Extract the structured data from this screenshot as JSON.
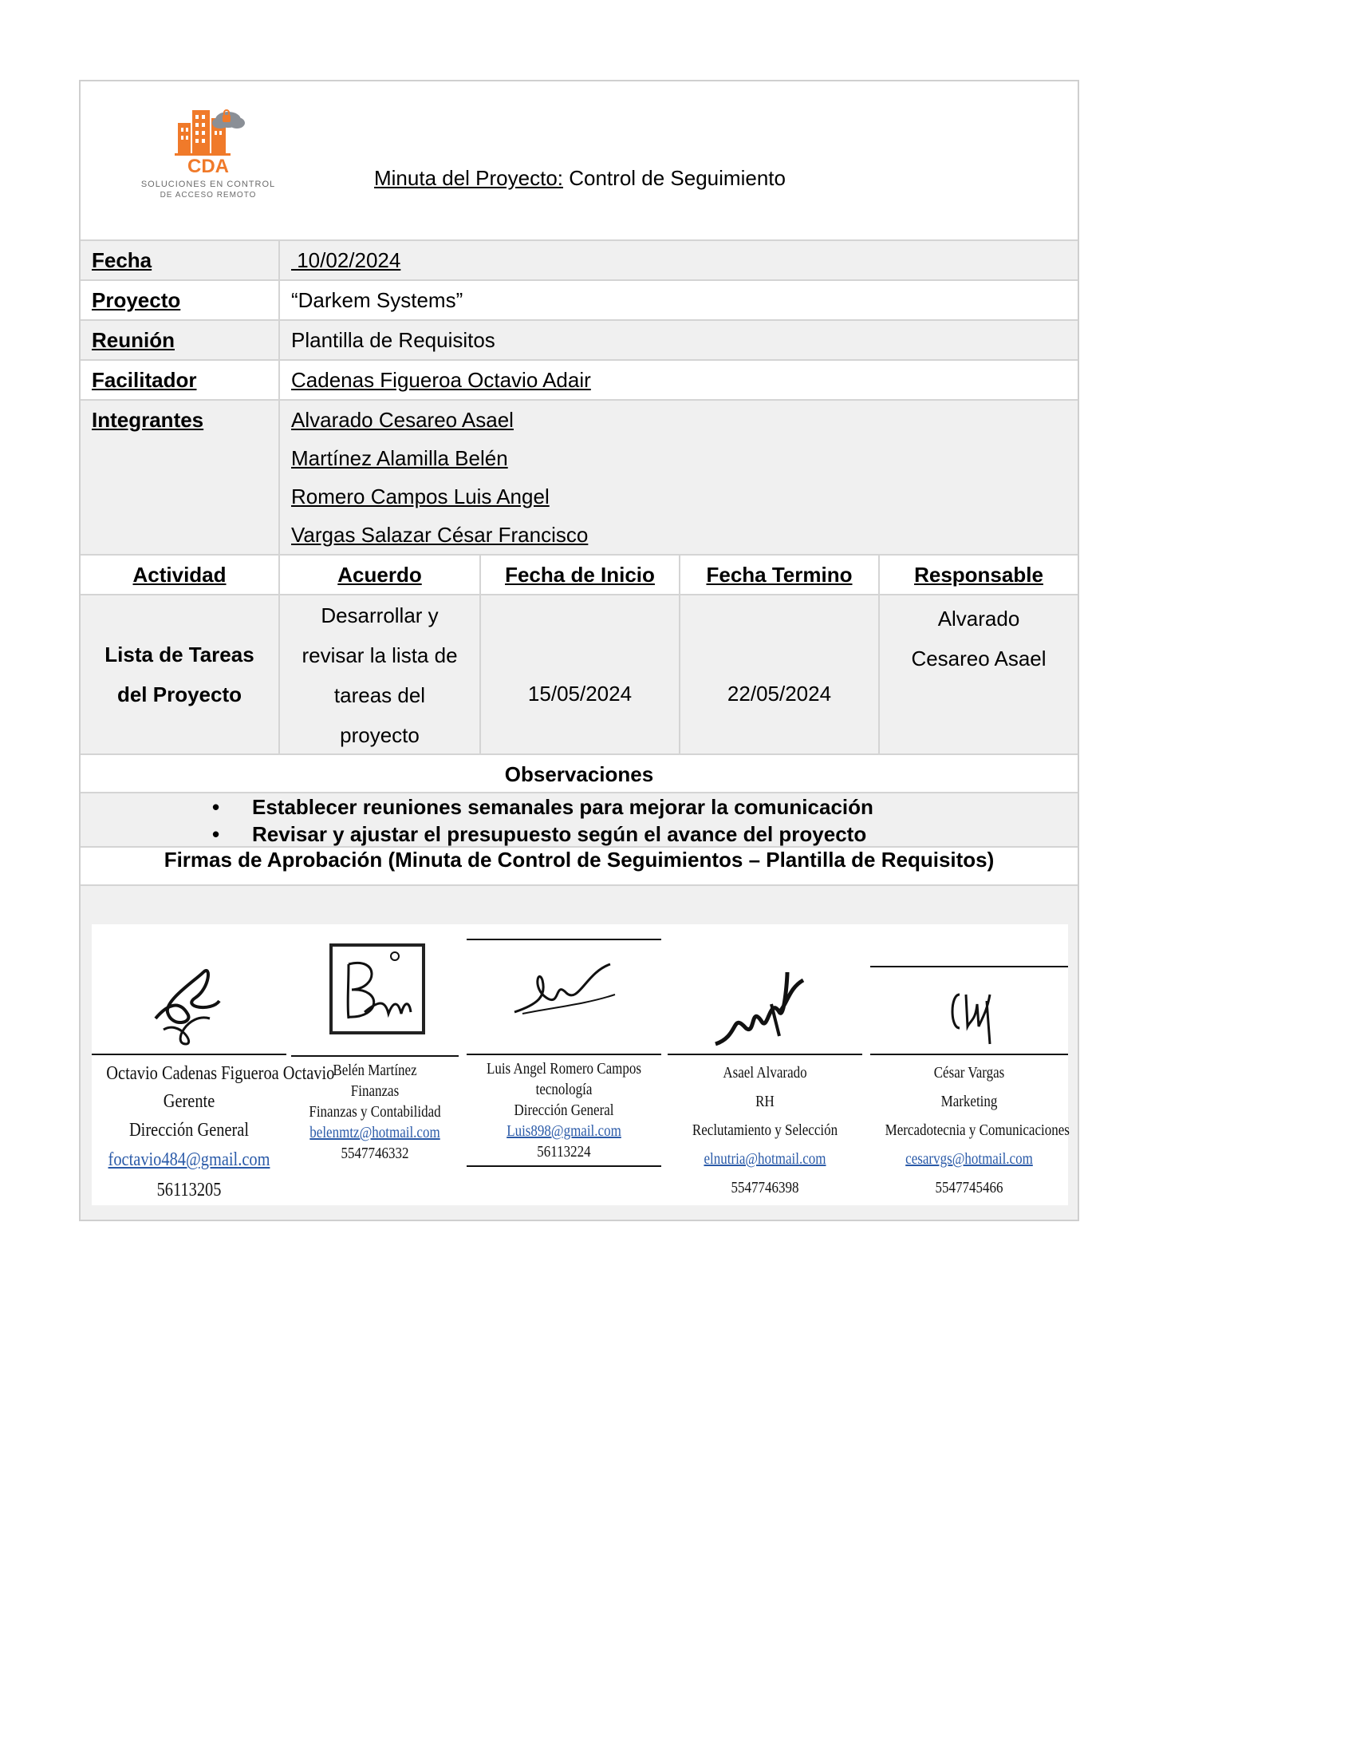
{
  "header": {
    "logo_text": "CDA",
    "logo_tagline_1": "SOLUCIONES EN CONTROL",
    "logo_tagline_2": "DE ACCESO REMOTO",
    "title_prefix": "Minuta del Proyecto:",
    "title_rest": " Control de Seguimiento"
  },
  "info": {
    "fecha_label": "Fecha",
    "fecha_value": " 10/02/2024",
    "proyecto_label": "Proyecto",
    "proyecto_value": "“Darkem Systems”",
    "reunion_label": "Reunión",
    "reunion_value": "Plantilla de Requisitos",
    "facilitador_label": "Facilitador",
    "facilitador_value": "Cadenas Figueroa Octavio Adair",
    "integrantes_label": "Integrantes",
    "integrantes": [
      "Alvarado Cesareo Asael",
      "Martínez Alamilla Belén",
      "Romero Campos Luis Angel",
      "Vargas Salazar César Francisco"
    ]
  },
  "activities": {
    "headers": [
      "Actividad",
      "Acuerdo",
      "Fecha de Inicio",
      "Fecha Termino",
      "Responsable"
    ],
    "row": {
      "actividad": [
        "Lista de Tareas",
        "del Proyecto"
      ],
      "acuerdo": [
        "Desarrollar y",
        "revisar la lista de",
        "tareas del",
        "proyecto"
      ],
      "inicio": "15/05/2024",
      "termino": "22/05/2024",
      "responsable": [
        "Alvarado",
        "Cesareo Asael"
      ]
    }
  },
  "observaciones": {
    "title": "Observaciones",
    "items": [
      "Establecer reuniones semanales para mejorar la comunicación",
      "Revisar y ajustar el presupuesto según el avance del proyecto"
    ]
  },
  "firmas": {
    "title": "Firmas de Aprobación (Minuta de Control de Seguimientos – Plantilla de Requisitos)",
    "signers": [
      {
        "lines": [
          "Octavio Cadenas Figueroa Octavio",
          "Gerente",
          "Dirección General"
        ],
        "email": "foctavio484@gmail.com",
        "phone": "56113205"
      },
      {
        "lines": [
          "Belén Martínez",
          "Finanzas",
          "Finanzas y Contabilidad"
        ],
        "email": "belenmtz@hotmail.com",
        "phone": "5547746332"
      },
      {
        "lines": [
          "Luis Angel Romero Campos",
          "tecnología",
          "Dirección General"
        ],
        "email": "Luis898@gmail.com",
        "phone": "56113224"
      },
      {
        "lines": [
          "Asael Alvarado",
          "RH",
          "Reclutamiento y Selección"
        ],
        "email": "elnutria@hotmail.com",
        "phone": "5547746398"
      },
      {
        "lines": [
          "César Vargas",
          "Marketing",
          "Mercadotecnia y Comunicaciones"
        ],
        "email": "cesarvgs@hotmail.com",
        "phone": "5547745466"
      }
    ]
  }
}
